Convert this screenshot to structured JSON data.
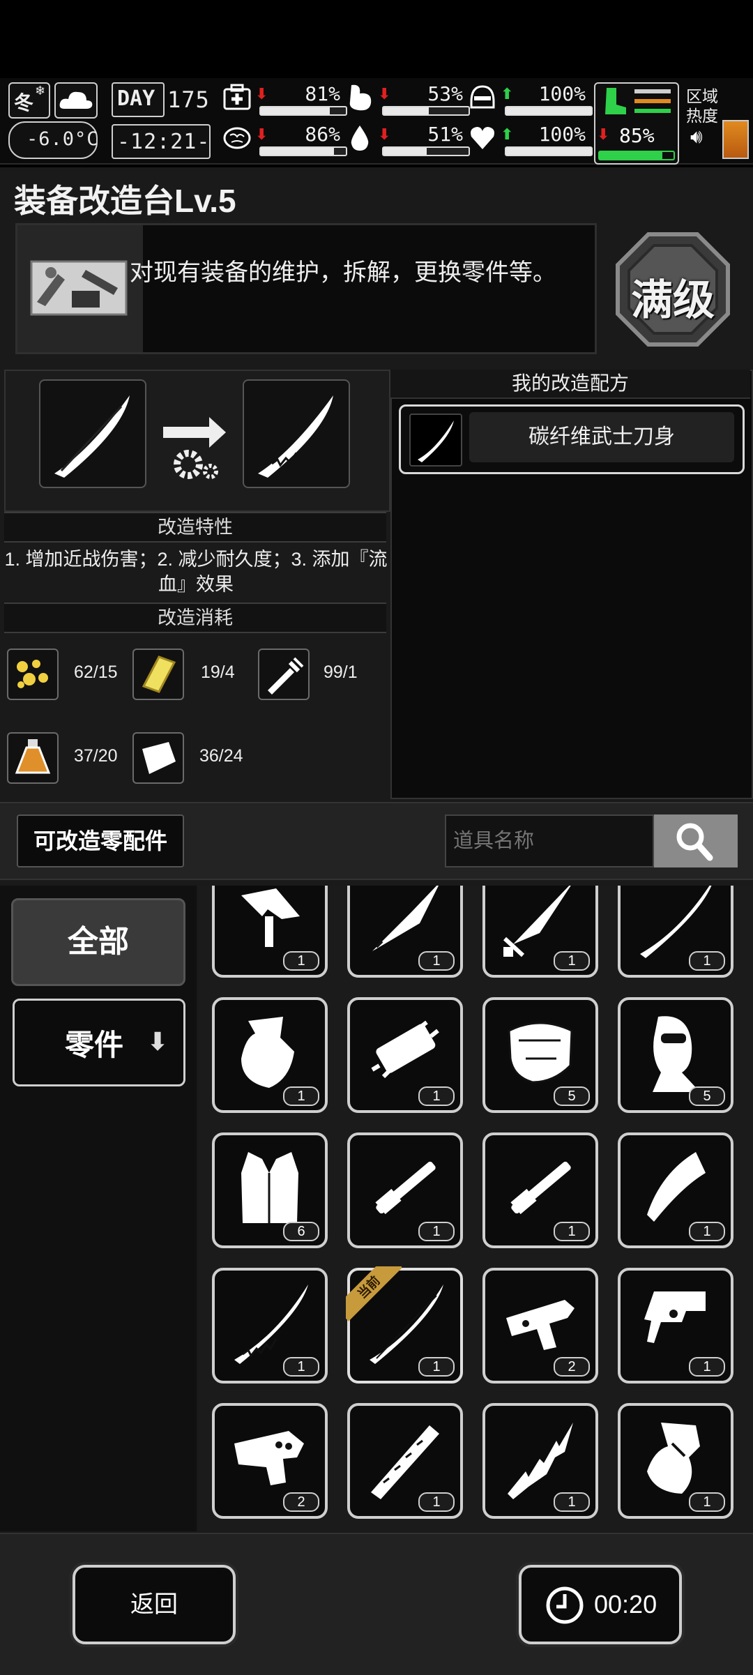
{
  "status": {
    "season": "冬",
    "temperature": "-6.0°C",
    "day_label": "DAY",
    "day_number": "175",
    "time": "-12:21-",
    "stats": [
      {
        "name": "health",
        "icon": "medkit-icon",
        "trend": "down",
        "value": "81%",
        "level": 0.81
      },
      {
        "name": "hunger",
        "icon": "stomach-icon",
        "trend": "down",
        "value": "53%",
        "level": 0.53
      },
      {
        "name": "armor",
        "icon": "helmet-icon",
        "trend": "up",
        "value": "100%",
        "level": 1.0
      },
      {
        "name": "sanity",
        "icon": "brain-icon",
        "trend": "down",
        "value": "86%",
        "level": 0.86
      },
      {
        "name": "thirst",
        "icon": "water-drop-icon",
        "trend": "down",
        "value": "51%",
        "level": 0.51
      },
      {
        "name": "mood",
        "icon": "heart-icon",
        "trend": "up",
        "value": "100%",
        "level": 1.0
      },
      {
        "name": "stamina",
        "icon": "boot-icon",
        "trend": "down",
        "value": "85%",
        "level": 0.85
      }
    ],
    "zone_heat_label": "区域热度"
  },
  "workbench": {
    "title": "装备改造台Lv.5",
    "description": "对现有装备的维护，拆解，更换零件等。",
    "max_badge": "满级"
  },
  "modify": {
    "feature_title": "改造特性",
    "feature_text": "1. 增加近战伤害；2. 减少耐久度；3. 添加『流血』效果",
    "cost_title": "改造消耗",
    "costs": [
      {
        "icon": "gold-nuggets-icon",
        "value": "62/15"
      },
      {
        "icon": "gold-bar-icon",
        "value": "19/4"
      },
      {
        "icon": "syringe-icon",
        "value": "99/1"
      },
      {
        "icon": "potion-flask-icon",
        "value": "37/20"
      },
      {
        "icon": "cloth-icon",
        "value": "36/24"
      }
    ]
  },
  "recipes": {
    "title": "我的改造配方",
    "items": [
      {
        "name": "碳纤维武士刀身",
        "icon": "katana-blade-icon"
      }
    ]
  },
  "filter": {
    "parts_button": "可改造零配件",
    "search_placeholder": "道具名称"
  },
  "categories": {
    "all": "全部",
    "parts": "零件"
  },
  "inventory": {
    "current_tag": "当前",
    "items": [
      {
        "icon": "axe-head-icon",
        "count": "1"
      },
      {
        "icon": "spear-head-icon",
        "count": "1"
      },
      {
        "icon": "dagger-blade-icon",
        "count": "1"
      },
      {
        "icon": "long-blade-icon",
        "count": "1"
      },
      {
        "icon": "broken-axe-icon",
        "count": "1"
      },
      {
        "icon": "spiked-cylinder-icon",
        "count": "1"
      },
      {
        "icon": "body-armor-icon",
        "count": "5"
      },
      {
        "icon": "balaclava-icon",
        "count": "5"
      },
      {
        "icon": "vest-icon",
        "count": "6"
      },
      {
        "icon": "barrel-icon",
        "count": "1"
      },
      {
        "icon": "barrel-icon",
        "count": "1"
      },
      {
        "icon": "claw-blade-icon",
        "count": "1"
      },
      {
        "icon": "serrated-blade-icon",
        "count": "1"
      },
      {
        "icon": "katana-blade-icon",
        "count": "1",
        "current": true
      },
      {
        "icon": "gun-receiver-icon",
        "count": "2"
      },
      {
        "icon": "gun-receiver-icon",
        "count": "1"
      },
      {
        "icon": "gun-receiver-icon",
        "count": "2"
      },
      {
        "icon": "serrated-sword-icon",
        "count": "1"
      },
      {
        "icon": "jagged-blade-icon",
        "count": "1"
      },
      {
        "icon": "axe-head-icon",
        "count": "1"
      }
    ]
  },
  "footer": {
    "back": "返回",
    "timer": "00:20"
  },
  "colors": {
    "accent_gold": "#c79a3c",
    "arrow_down": "#e02020",
    "arrow_up": "#2fd04a",
    "stamina_green": "#2fd04a"
  }
}
